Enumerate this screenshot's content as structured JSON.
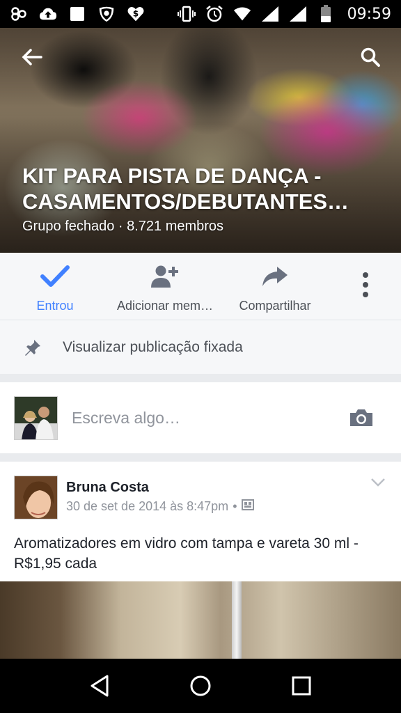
{
  "status_bar": {
    "time": "09:59",
    "left_icons": [
      "link-icon",
      "cloud-upload-icon",
      "stop-icon",
      "shield-icon",
      "dollar-heart-icon"
    ],
    "right_icons": [
      "vibrate-icon",
      "alarm-icon",
      "wifi-icon",
      "signal-icon",
      "signal-icon",
      "battery-icon"
    ]
  },
  "cover": {
    "title_line1": "KIT PARA PISTA DE DANÇA -",
    "title_line2": "CASAMENTOS/DEBUTANTES…",
    "subtitle": "Grupo fechado · 8.721 membros"
  },
  "actions": {
    "joined_label": "Entrou",
    "add_member_label": "Adicionar mem…",
    "share_label": "Compartilhar"
  },
  "pinned": {
    "label": "Visualizar publicação fixada"
  },
  "composer": {
    "placeholder": "Escreva algo…"
  },
  "post": {
    "author": "Bruna Costa",
    "timestamp": "30 de set de 2014 às 8:47pm",
    "separator": "•",
    "text": "Aromatizadores em vidro com tampa e vareta 30 ml - R$1,95 cada"
  },
  "colors": {
    "accent": "#4080ff",
    "muted_text": "#90949c",
    "icon_gray": "#6a7180"
  }
}
